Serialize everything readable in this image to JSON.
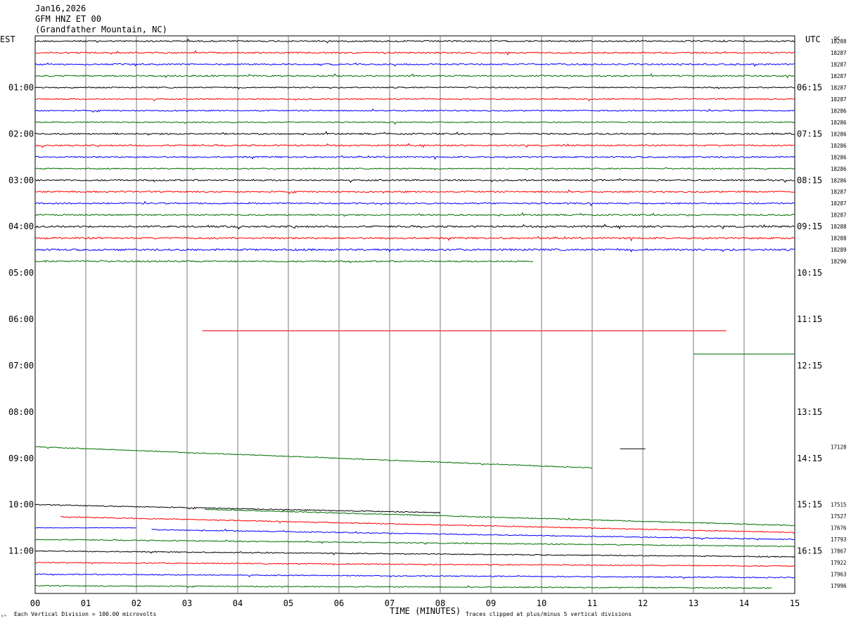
{
  "header": {
    "date": "Jan16,2026",
    "station": "GFM HNZ ET 00",
    "location": "(Grandfather Mountain, NC)"
  },
  "labels": {
    "left_zone": "EST",
    "right_zone": "UTC",
    "dc_header": "DC",
    "xlabel": "TIME (MINUTES)",
    "scale_note": "Each Vertical Division =  100.00 microvolts",
    "clip_note": "Traces clipped at plus/minus 5 vertical divisions",
    "corner_mark": "ᵍᵐ"
  },
  "chart_data": {
    "type": "line",
    "title": "GFM HNZ ET 00 (Grandfather Mountain, NC)",
    "xlabel": "TIME (MINUTES)",
    "xlim": [
      0,
      15
    ],
    "x_ticks": [
      "00",
      "01",
      "02",
      "03",
      "04",
      "05",
      "06",
      "07",
      "08",
      "09",
      "10",
      "11",
      "12",
      "13",
      "14",
      "15"
    ],
    "rows_per_hour": 4,
    "row_count": 48,
    "est_labels": [
      {
        "row": 4,
        "text": "01:00"
      },
      {
        "row": 8,
        "text": "02:00"
      },
      {
        "row": 12,
        "text": "03:00"
      },
      {
        "row": 16,
        "text": "04:00"
      },
      {
        "row": 20,
        "text": "05:00"
      },
      {
        "row": 24,
        "text": "06:00"
      },
      {
        "row": 28,
        "text": "07:00"
      },
      {
        "row": 32,
        "text": "08:00"
      },
      {
        "row": 36,
        "text": "09:00"
      },
      {
        "row": 40,
        "text": "10:00"
      },
      {
        "row": 44,
        "text": "11:00"
      }
    ],
    "utc_labels": [
      {
        "row": 4,
        "text": "06:15"
      },
      {
        "row": 8,
        "text": "07:15"
      },
      {
        "row": 12,
        "text": "08:15"
      },
      {
        "row": 16,
        "text": "09:15"
      },
      {
        "row": 20,
        "text": "10:15"
      },
      {
        "row": 24,
        "text": "11:15"
      },
      {
        "row": 28,
        "text": "12:15"
      },
      {
        "row": 32,
        "text": "13:15"
      },
      {
        "row": 36,
        "text": "14:15"
      },
      {
        "row": 40,
        "text": "15:15"
      },
      {
        "row": 44,
        "text": "16:15"
      }
    ],
    "dc_labels": [
      {
        "row": 0,
        "text": "18288"
      },
      {
        "row": 1,
        "text": "18287"
      },
      {
        "row": 2,
        "text": "18287"
      },
      {
        "row": 3,
        "text": "18287"
      },
      {
        "row": 4,
        "text": "18287"
      },
      {
        "row": 5,
        "text": "18287"
      },
      {
        "row": 6,
        "text": "18286"
      },
      {
        "row": 7,
        "text": "18286"
      },
      {
        "row": 8,
        "text": "18286"
      },
      {
        "row": 9,
        "text": "18286"
      },
      {
        "row": 10,
        "text": "18286"
      },
      {
        "row": 11,
        "text": "18286"
      },
      {
        "row": 12,
        "text": "18286"
      },
      {
        "row": 13,
        "text": "18287"
      },
      {
        "row": 14,
        "text": "18287"
      },
      {
        "row": 15,
        "text": "18287"
      },
      {
        "row": 16,
        "text": "18288"
      },
      {
        "row": 17,
        "text": "18288"
      },
      {
        "row": 18,
        "text": "18289"
      },
      {
        "row": 19,
        "text": "18290"
      },
      {
        "row": 35,
        "text": "17128"
      },
      {
        "row": 40,
        "text": "17515"
      },
      {
        "row": 41,
        "text": "17527"
      },
      {
        "row": 42,
        "text": "17676"
      },
      {
        "row": 43,
        "text": "17793"
      },
      {
        "row": 44,
        "text": "17867"
      },
      {
        "row": 45,
        "text": "17922"
      },
      {
        "row": 46,
        "text": "17963"
      },
      {
        "row": 47,
        "text": "17996"
      }
    ],
    "trace_colors": [
      "#000000",
      "#ff0000",
      "#0000ff",
      "#007000"
    ],
    "traces": [
      {
        "row": 0,
        "x0": 0,
        "x1": 15,
        "drift": 0,
        "noise": 1.0
      },
      {
        "row": 1,
        "x0": 0,
        "x1": 15,
        "drift": 0,
        "noise": 1.0
      },
      {
        "row": 2,
        "x0": 0,
        "x1": 15,
        "drift": 0,
        "noise": 1.0
      },
      {
        "row": 3,
        "x0": 0,
        "x1": 15,
        "drift": 0,
        "noise": 1.0
      },
      {
        "row": 4,
        "x0": 0,
        "x1": 15,
        "drift": 0,
        "noise": 0.8
      },
      {
        "row": 5,
        "x0": 0,
        "x1": 15,
        "drift": 0,
        "noise": 0.8
      },
      {
        "row": 6,
        "x0": 0,
        "x1": 15,
        "drift": 0,
        "noise": 0.8
      },
      {
        "row": 7,
        "x0": 0,
        "x1": 15,
        "drift": 0,
        "noise": 0.8
      },
      {
        "row": 8,
        "x0": 0,
        "x1": 15,
        "drift": 0,
        "noise": 1.0
      },
      {
        "row": 9,
        "x0": 0,
        "x1": 15,
        "drift": 0,
        "noise": 1.0
      },
      {
        "row": 10,
        "x0": 0,
        "x1": 15,
        "drift": 0,
        "noise": 1.0
      },
      {
        "row": 11,
        "x0": 0,
        "x1": 15,
        "drift": 0,
        "noise": 0.8
      },
      {
        "row": 12,
        "x0": 0,
        "x1": 15,
        "drift": 0,
        "noise": 1.0
      },
      {
        "row": 13,
        "x0": 0,
        "x1": 15,
        "drift": 0,
        "noise": 1.0
      },
      {
        "row": 14,
        "x0": 0,
        "x1": 15,
        "drift": 0,
        "noise": 1.0
      },
      {
        "row": 15,
        "x0": 0,
        "x1": 15,
        "drift": 0,
        "noise": 1.0
      },
      {
        "row": 16,
        "x0": 0,
        "x1": 15,
        "drift": 0,
        "noise": 1.2
      },
      {
        "row": 17,
        "x0": 0,
        "x1": 15,
        "drift": 0,
        "noise": 1.2
      },
      {
        "row": 18,
        "x0": 0,
        "x1": 15,
        "drift": 0,
        "noise": 1.3
      },
      {
        "row": 19,
        "x0": 0,
        "x1": 9.83,
        "drift": 0,
        "noise": 1.0
      },
      {
        "row": 25,
        "x0": 3.3,
        "x1": 13.65,
        "drift": 0,
        "noise": 0
      },
      {
        "row": 27,
        "x0": 13.0,
        "x1": 15,
        "drift": 0,
        "noise": 0
      },
      {
        "row": 35,
        "x0": 0,
        "x1": 11.0,
        "drift": 2.5,
        "noise": 0.6
      },
      {
        "row": 35,
        "x0": 11.55,
        "x1": 12.05,
        "drift": 0,
        "noise": 0,
        "color": "#000000",
        "offset": 3
      },
      {
        "row": 40,
        "x0": 0,
        "x1": 8.0,
        "drift": 1.3,
        "noise": 0.7
      },
      {
        "row": 40,
        "x0": 3.35,
        "x1": 15,
        "drift": 1.8,
        "noise": 0.7,
        "color": "#007000"
      },
      {
        "row": 41,
        "x0": 0.5,
        "x1": 15,
        "drift": 1.4,
        "noise": 0.7
      },
      {
        "row": 42,
        "x0": 0,
        "x1": 2.0,
        "drift": 0,
        "noise": 0.3
      },
      {
        "row": 42,
        "x0": 2.3,
        "x1": 15,
        "drift": 1.0,
        "noise": 0.7
      },
      {
        "row": 43,
        "x0": 0,
        "x1": 15,
        "drift": 0.6,
        "noise": 0.7
      },
      {
        "row": 44,
        "x0": 0,
        "x1": 15,
        "drift": 0.5,
        "noise": 0.7
      },
      {
        "row": 45,
        "x0": 0,
        "x1": 15,
        "drift": 0.3,
        "noise": 0.7
      },
      {
        "row": 46,
        "x0": 0,
        "x1": 15,
        "drift": 0.3,
        "noise": 0.7
      },
      {
        "row": 47,
        "x0": 0,
        "x1": 14.55,
        "drift": 0.2,
        "noise": 0.7
      }
    ]
  }
}
